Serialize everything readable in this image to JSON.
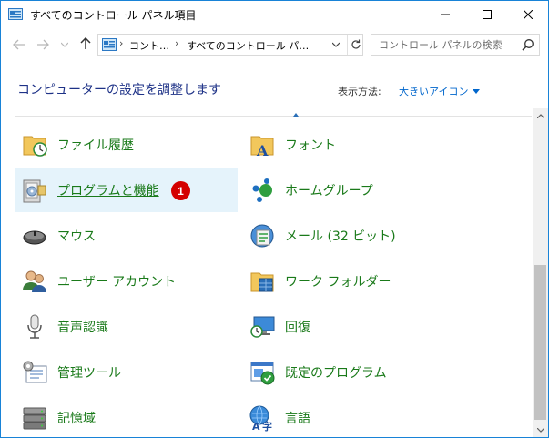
{
  "window": {
    "title": "すべてのコントロール パネル項目"
  },
  "address": {
    "crumbs": [
      "コント…",
      "すべてのコントロール パ…"
    ],
    "separator": "›"
  },
  "search": {
    "placeholder": "コントロール パネルの検索"
  },
  "header": {
    "title": "コンピューターの設定を調整します",
    "view_label": "表示方法:",
    "view_value": "大きいアイコン"
  },
  "items": {
    "left": [
      {
        "label": "ファイル履歴",
        "icon": "file-history-icon"
      },
      {
        "label": "プログラムと機能",
        "icon": "programs-features-icon",
        "selected": true,
        "badge": "1"
      },
      {
        "label": "マウス",
        "icon": "mouse-icon"
      },
      {
        "label": "ユーザー アカウント",
        "icon": "user-accounts-icon"
      },
      {
        "label": "音声認識",
        "icon": "microphone-icon"
      },
      {
        "label": "管理ツール",
        "icon": "admin-tools-icon"
      },
      {
        "label": "記憶域",
        "icon": "storage-icon"
      }
    ],
    "right": [
      {
        "label": "フォント",
        "icon": "fonts-icon"
      },
      {
        "label": "ホームグループ",
        "icon": "homegroup-icon"
      },
      {
        "label": "メール (32 ビット)",
        "icon": "mail-icon"
      },
      {
        "label": "ワーク フォルダー",
        "icon": "work-folders-icon"
      },
      {
        "label": "回復",
        "icon": "recovery-icon"
      },
      {
        "label": "既定のプログラム",
        "icon": "default-programs-icon"
      },
      {
        "label": "言語",
        "icon": "language-icon"
      }
    ]
  },
  "colors": {
    "link_green": "#1a7a1a",
    "heading_blue": "#1e3287",
    "selection": "#e5f3fb",
    "badge_red": "#d40000",
    "window_border": "#1883d7"
  }
}
